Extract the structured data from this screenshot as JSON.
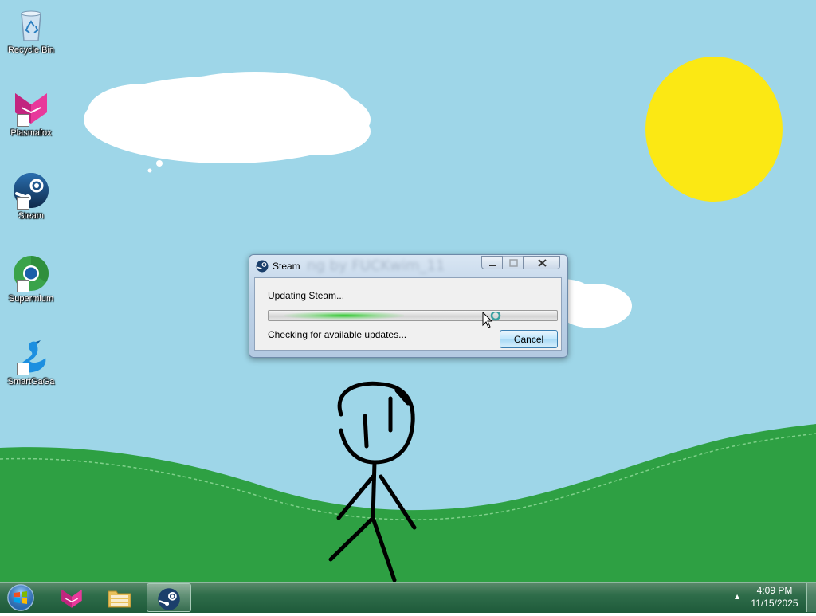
{
  "desktop": {
    "icons": [
      {
        "label": "Recycle Bin",
        "icon": "recycle-bin-icon"
      },
      {
        "label": "Plasmafox",
        "icon": "plasmafox-icon"
      },
      {
        "label": "Steam",
        "icon": "steam-icon"
      },
      {
        "label": "Supermium",
        "icon": "supermium-icon"
      },
      {
        "label": "SmartGaGa",
        "icon": "smartgaga-icon"
      }
    ]
  },
  "steam_dialog": {
    "title": "Steam",
    "background_text": "ng by FUCKwim_11",
    "status": "Updating Steam...",
    "detail": "Checking for available updates...",
    "cancel_label": "Cancel",
    "progress_state": "indeterminate"
  },
  "taskbar": {
    "buttons": [
      {
        "name": "start",
        "icon": "windows-orb-icon"
      },
      {
        "name": "plasmafox",
        "icon": "plasmafox-icon"
      },
      {
        "name": "file-explorer",
        "icon": "folder-icon"
      },
      {
        "name": "steam",
        "icon": "steam-icon",
        "active": true
      }
    ],
    "clock": {
      "time": "4:09 PM",
      "date": "11/15/2025"
    }
  },
  "colors": {
    "sky": "#9ed6e8",
    "grass": "#2ea043",
    "sun": "#fbe814",
    "taskbar": "#2f6d4a"
  }
}
